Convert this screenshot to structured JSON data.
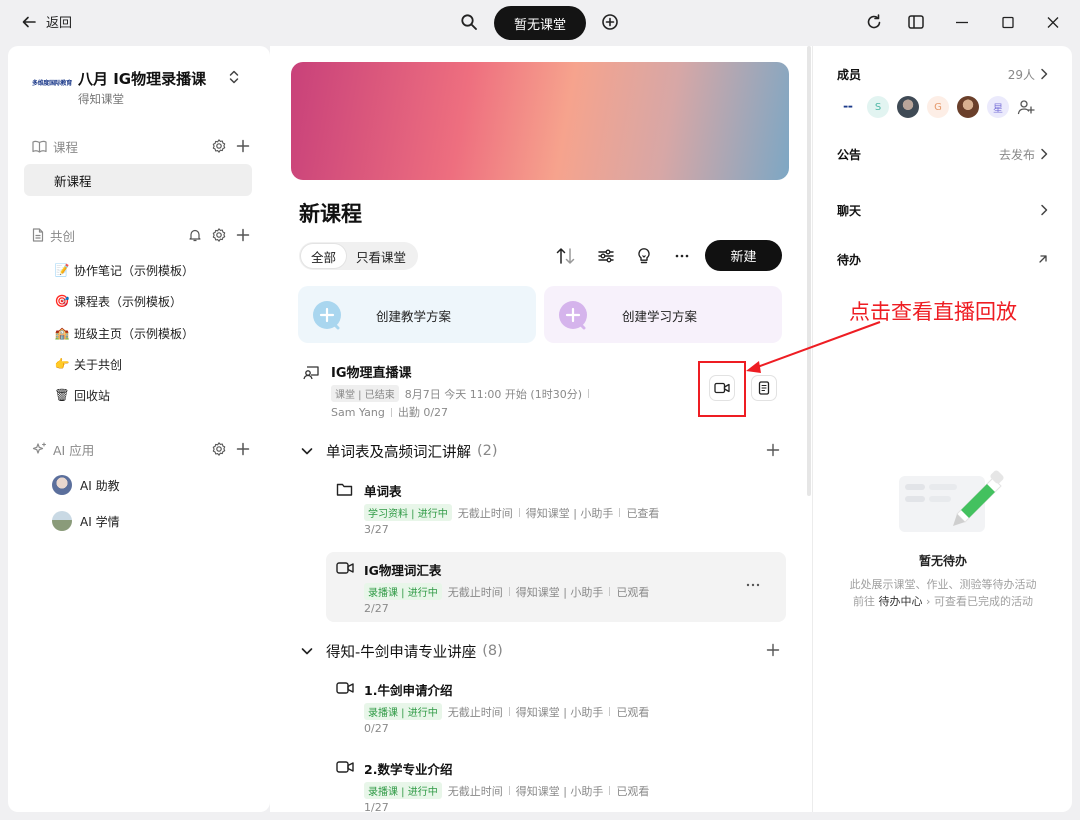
{
  "topbar": {
    "back_label": "返回",
    "center_pill": "暂无课堂"
  },
  "sidebar": {
    "brand_logo_text": "多维度国际教育",
    "brand_title": "八月 IG物理录播课",
    "brand_subtitle": "得知课堂",
    "course_section": "课程",
    "course_items": [
      "新课程"
    ],
    "cocreate_section": "共创",
    "cocreate_items": [
      {
        "label": "协作笔记（示例模板）",
        "emoji": "📝"
      },
      {
        "label": "课程表（示例模板）",
        "emoji": "🎯"
      },
      {
        "label": "班级主页（示例模板）",
        "emoji": "🏫"
      },
      {
        "label": "关于共创",
        "emoji": "👉"
      },
      {
        "label": "回收站",
        "emoji": "🗑"
      }
    ],
    "ai_section": "AI 应用",
    "ai_items": [
      "AI 助教",
      "AI 学情"
    ]
  },
  "main": {
    "page_title": "新课程",
    "filter_all": "全部",
    "filter_class_only": "只看课堂",
    "new_button": "新建",
    "card_teach": "创建教学方案",
    "card_learn": "创建学习方案",
    "live": {
      "title": "IG物理直播课",
      "tag": "课堂 | 已结束",
      "time": "8月7日 今天 11:00 开始 (1时30分)",
      "teacher": "Sam Yang",
      "attendance": "出勤 0/27"
    },
    "groups": [
      {
        "title": "单词表及高频词汇讲解",
        "count": "(2)",
        "items": [
          {
            "title": "单词表",
            "tag": "学习资料 | 进行中",
            "deadline": "无截止时间",
            "author": "得知课堂 | 小助手",
            "status": "已查看",
            "count": "3/27"
          },
          {
            "title": "IG物理词汇表",
            "tag": "录播课 | 进行中",
            "deadline": "无截止时间",
            "author": "得知课堂 | 小助手",
            "status": "已观看",
            "count": "2/27"
          }
        ]
      },
      {
        "title": "得知-牛剑申请专业讲座",
        "count": "(8)",
        "items": [
          {
            "title": "1.牛剑申请介绍",
            "tag": "录播课 | 进行中",
            "deadline": "无截止时间",
            "author": "得知课堂 | 小助手",
            "status": "已观看",
            "count": "0/27"
          },
          {
            "title": "2.数学专业介绍",
            "tag": "录播课 | 进行中",
            "deadline": "无截止时间",
            "author": "得知课堂 | 小助手",
            "status": "已观看",
            "count": "1/27"
          }
        ]
      }
    ]
  },
  "annotation": {
    "text": "点击查看直播回放",
    "color": "#ee1d23"
  },
  "right": {
    "members_label": "成员",
    "members_count": "29人",
    "member_avatars": [
      "S",
      "G",
      "星"
    ],
    "notice_label": "公告",
    "notice_action": "去发布",
    "chat_label": "聊天",
    "todo_label": "待办",
    "empty_title": "暂无待办",
    "empty_line1": "此处展示课堂、作业、测验等待办活动",
    "empty_prefix": "前往",
    "empty_link": "待办中心",
    "empty_suffix": "可查看已完成的活动"
  }
}
